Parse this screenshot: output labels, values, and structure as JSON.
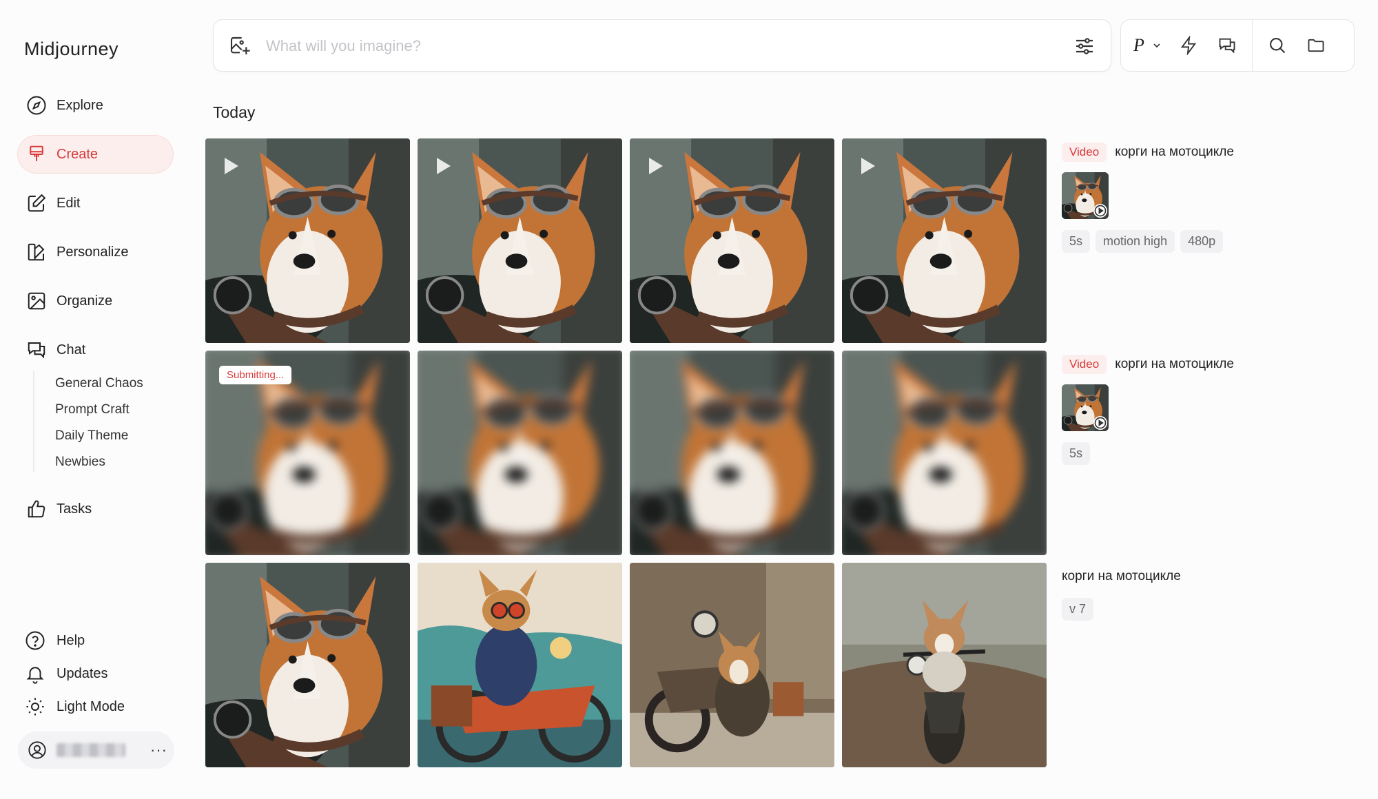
{
  "app": {
    "title": "Midjourney"
  },
  "nav": [
    {
      "label": "Explore",
      "icon": "compass-icon"
    },
    {
      "label": "Create",
      "icon": "brush-icon",
      "active": true
    },
    {
      "label": "Edit",
      "icon": "edit-icon"
    },
    {
      "label": "Personalize",
      "icon": "personalize-icon"
    },
    {
      "label": "Organize",
      "icon": "image-icon"
    },
    {
      "label": "Chat",
      "icon": "chat-icon"
    },
    {
      "label": "Tasks",
      "icon": "thumbs-up-icon"
    }
  ],
  "chat_channels": [
    "General Chaos",
    "Prompt Craft",
    "Daily Theme",
    "Newbies"
  ],
  "bottom": {
    "help": "Help",
    "updates": "Updates",
    "light_mode": "Light Mode",
    "more": "···"
  },
  "search": {
    "placeholder": "What will you imagine?",
    "value": ""
  },
  "toolbar": {
    "p_label": "P"
  },
  "section": {
    "title": "Today"
  },
  "accent_color": "#d83a3a",
  "jobs": [
    {
      "tag": "Video",
      "prompt": "корги на мотоцикле",
      "chips": [
        "5s",
        "motion high",
        "480p"
      ],
      "status": ""
    },
    {
      "tag": "Video",
      "prompt": "корги на мотоцикле",
      "chips": [
        "5s"
      ],
      "status": "Submitting..."
    },
    {
      "tag": "",
      "prompt": "корги на мотоцикле",
      "chips": [
        "v 7"
      ],
      "status": ""
    }
  ]
}
